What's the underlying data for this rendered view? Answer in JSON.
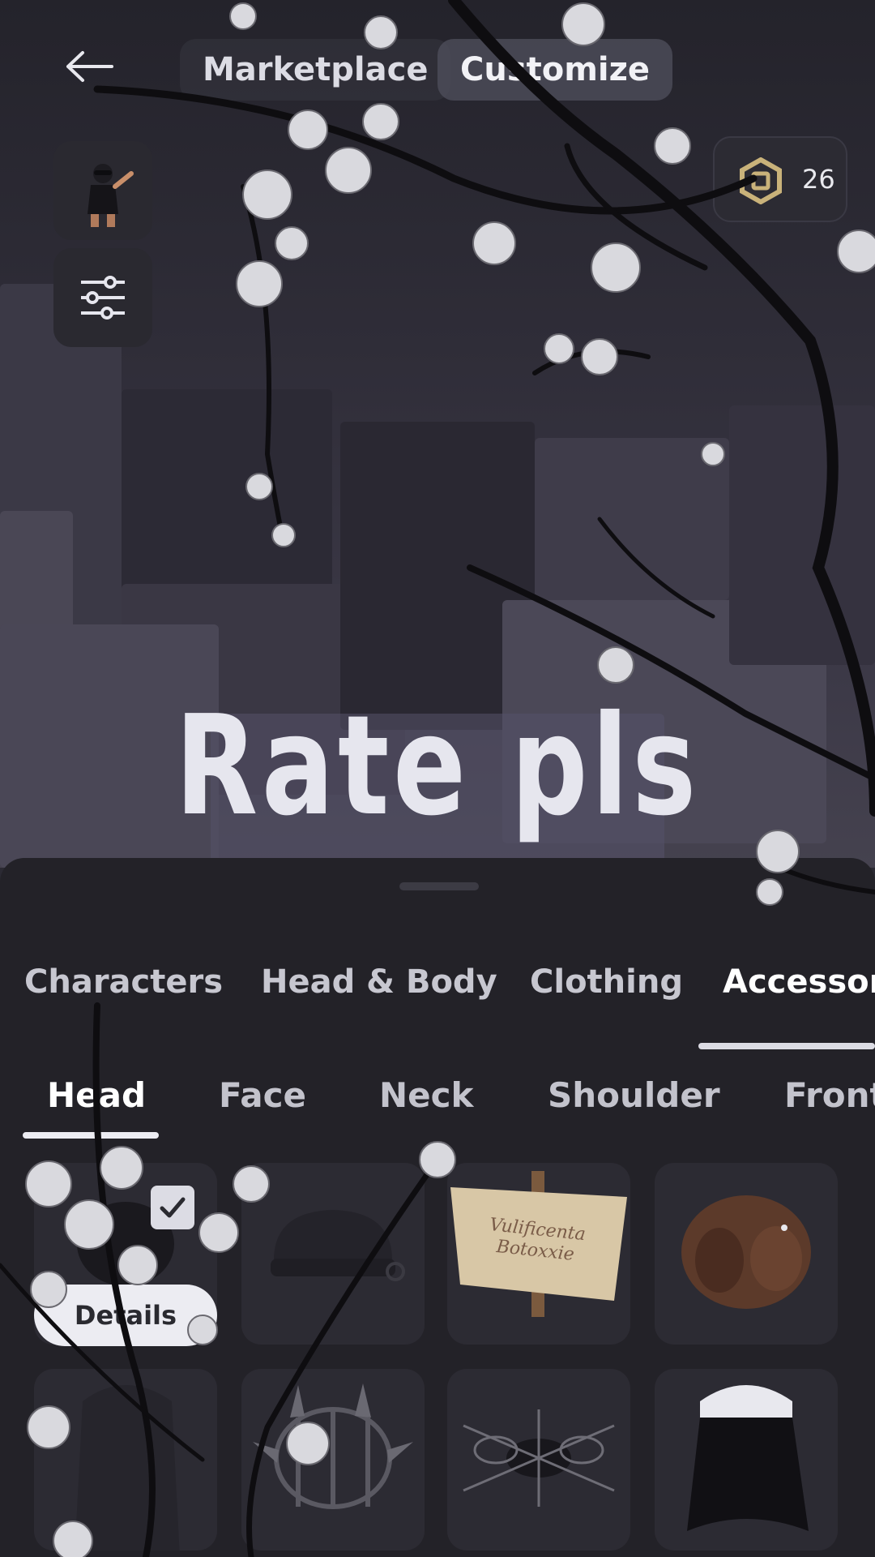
{
  "header": {
    "back_icon": "back-arrow-icon",
    "tabs": [
      {
        "label": "Marketplace",
        "active": false
      },
      {
        "label": "Customize",
        "active": true
      }
    ]
  },
  "side_buttons": {
    "avatar_icon": "avatar-thumbnail",
    "filter_icon": "sliders-icon"
  },
  "currency": {
    "icon": "robux-icon",
    "amount": "26",
    "icon_color": "#c9b27a"
  },
  "overlay_text": "Rate pls",
  "categories": {
    "items": [
      {
        "label": "Characters",
        "active": false
      },
      {
        "label": "Head & Body",
        "active": false
      },
      {
        "label": "Clothing",
        "active": false
      },
      {
        "label": "Accessor",
        "active": true
      }
    ]
  },
  "subcategories": {
    "items": [
      {
        "label": "Head",
        "active": true
      },
      {
        "label": "Face",
        "active": false
      },
      {
        "label": "Neck",
        "active": false
      },
      {
        "label": "Shoulder",
        "active": false
      },
      {
        "label": "Front",
        "active": false
      }
    ]
  },
  "grid": {
    "details_label": "Details",
    "checkmark_icon": "checkmark-icon",
    "items": [
      {
        "name": "equipped-item",
        "icon": "hair-icon"
      },
      {
        "name": "black-cap",
        "icon": "cap-icon"
      },
      {
        "name": "sign-hat",
        "icon": "sign-icon",
        "sign_text": "Vulificenta Botoxxie"
      },
      {
        "name": "brown-hair",
        "icon": "hair-icon"
      },
      {
        "name": "dark-hood",
        "icon": "hood-icon"
      },
      {
        "name": "spiked-cage",
        "icon": "cage-icon"
      },
      {
        "name": "thorn-crown",
        "icon": "crown-icon"
      },
      {
        "name": "black-veil",
        "icon": "veil-icon"
      }
    ]
  },
  "colors": {
    "panel": "#232228",
    "tile": "#2c2b33",
    "accent": "#ececf2"
  }
}
